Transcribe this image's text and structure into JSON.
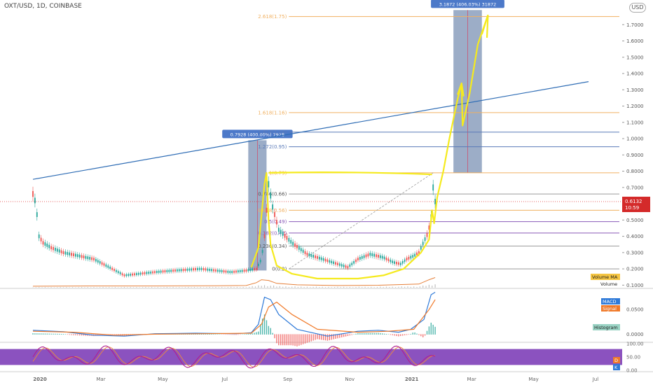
{
  "header": {
    "title": "OXT/USD, 1D, COINBASE",
    "currency_button": "USD"
  },
  "colors": {
    "fib_line": "#f0b060",
    "fib_blue": "#5a7ab8",
    "fib_purple": "#8a5ab8",
    "fib_gray": "#9a9a9a",
    "trendline": "#2f6db5",
    "highlight": "#f5ea1e",
    "measure_box": "#7b91b4",
    "price_line": "#e03030",
    "volume_ma": "#e6803a",
    "macd": "#2f7ad8",
    "signal": "#f07a2a",
    "rsi_band": "#7e3fb8",
    "rsi_line": "#b01f8f",
    "up": "#26a69a",
    "down": "#ef5350"
  },
  "chart_data": [
    {
      "type": "line",
      "name": "price",
      "ylim": [
        0.08,
        1.8
      ],
      "ticks": [
        "1.7000",
        "1.6000",
        "1.5000",
        "1.4000",
        "1.3000",
        "1.2000",
        "1.1000",
        "1.0000",
        "0.9000",
        "0.8000",
        "0.7000",
        "0.6000",
        "0.5000",
        "0.4000",
        "0.3000",
        "0.2000",
        "0.1000"
      ],
      "tick_values": [
        1.7,
        1.6,
        1.5,
        1.4,
        1.3,
        1.2,
        1.1,
        1.0,
        0.9,
        0.8,
        0.7,
        0.6,
        0.5,
        0.4,
        0.3,
        0.2,
        0.1
      ],
      "x_labels": [
        "2020",
        "Mar",
        "May",
        "Jul",
        "Sep",
        "Nov",
        "2021",
        "Mar",
        "May",
        "Jul"
      ],
      "x_label_days": [
        0,
        60,
        121,
        182,
        244,
        305,
        366,
        425,
        486,
        547
      ],
      "series_days": [
        0,
        3,
        6,
        10,
        18,
        30,
        45,
        60,
        75,
        90,
        105,
        120,
        140,
        165,
        180,
        195,
        210,
        220,
        225,
        228,
        232,
        236,
        242,
        255,
        270,
        285,
        300,
        310,
        320,
        332,
        345,
        355,
        362,
        368,
        375,
        380,
        385,
        389,
        392,
        394,
        396
      ],
      "series_values": [
        0.66,
        0.6,
        0.4,
        0.36,
        0.33,
        0.3,
        0.28,
        0.26,
        0.21,
        0.16,
        0.17,
        0.18,
        0.19,
        0.2,
        0.19,
        0.18,
        0.19,
        0.2,
        0.26,
        0.4,
        0.72,
        0.58,
        0.44,
        0.36,
        0.29,
        0.26,
        0.23,
        0.21,
        0.26,
        0.29,
        0.27,
        0.24,
        0.23,
        0.26,
        0.28,
        0.3,
        0.37,
        0.42,
        0.52,
        0.7,
        0.6132
      ],
      "current_price": "0.6132",
      "countdown": "10:59",
      "fib_levels": [
        {
          "label": "2.618(1.75)",
          "value": 1.75
        },
        {
          "label": "1.618(1.16)",
          "value": 1.16
        },
        {
          "label": "1.414(1.04)",
          "value": 1.04
        },
        {
          "label": "1.272(0.95)",
          "value": 0.95
        },
        {
          "label": "1(0.79)",
          "value": 0.79
        },
        {
          "label": "0.786(0.66)",
          "value": 0.66
        },
        {
          "label": "0.618(0.56)",
          "value": 0.56
        },
        {
          "label": "0.5(0.49)",
          "value": 0.49
        },
        {
          "label": "0.382(0.42)",
          "value": 0.42
        },
        {
          "label": "0.236(0.34)",
          "value": 0.34
        },
        {
          "label": "0(0.2)",
          "value": 0.2
        }
      ],
      "measure_1": {
        "label": "0.7928 (400.00%) 7928",
        "day_start": 212,
        "day_end": 230,
        "low": 0.19,
        "high": 0.99
      },
      "measure_2": {
        "label": "3.1872 (406.03%) 31872",
        "day_start": 414,
        "day_end": 442,
        "low": 0.79,
        "high": 1.79
      },
      "trendline": {
        "day_start": 0,
        "value_start": 0.75,
        "day_end": 547,
        "value_end": 1.35
      }
    },
    {
      "type": "bar",
      "name": "volume",
      "legend": [
        "Volume MA",
        "Volume"
      ],
      "ma_days": [
        0,
        60,
        120,
        180,
        210,
        220,
        225,
        232,
        240,
        260,
        300,
        340,
        380,
        390,
        396
      ],
      "ma_values": [
        0.1,
        0.12,
        0.12,
        0.13,
        0.15,
        0.35,
        0.55,
        0.5,
        0.3,
        0.2,
        0.15,
        0.17,
        0.25,
        0.55,
        0.7
      ]
    },
    {
      "type": "line",
      "name": "macd",
      "legend": [
        "MACD",
        "Signal",
        "Histogram"
      ],
      "ticks": [
        "0.0500",
        "0.0000"
      ],
      "tick_values": [
        0.05,
        0.0
      ],
      "ylim": [
        -0.015,
        0.09
      ],
      "macd_days": [
        0,
        30,
        60,
        90,
        120,
        160,
        200,
        215,
        222,
        228,
        234,
        242,
        260,
        290,
        320,
        340,
        360,
        372,
        385,
        392,
        396
      ],
      "macd_values": [
        0.008,
        0.005,
        -0.002,
        -0.004,
        0.001,
        0.002,
        0.001,
        0.003,
        0.02,
        0.075,
        0.07,
        0.04,
        0.01,
        -0.004,
        0.006,
        0.008,
        0.004,
        0.01,
        0.03,
        0.08,
        0.085
      ],
      "signal_days": [
        0,
        40,
        80,
        120,
        170,
        215,
        225,
        232,
        240,
        255,
        280,
        320,
        350,
        375,
        390,
        396
      ],
      "signal_values": [
        0.006,
        0.004,
        -0.002,
        0.0,
        0.001,
        0.002,
        0.02,
        0.055,
        0.065,
        0.04,
        0.01,
        0.004,
        0.006,
        0.01,
        0.05,
        0.07
      ]
    },
    {
      "type": "line",
      "name": "stoch_rsi",
      "ticks": [
        "100.00",
        "50.00",
        "0.00"
      ],
      "tick_values": [
        100,
        50,
        0
      ],
      "ylim": [
        0,
        100
      ],
      "band": [
        20,
        80
      ],
      "legend": [
        "D",
        "K"
      ]
    }
  ]
}
